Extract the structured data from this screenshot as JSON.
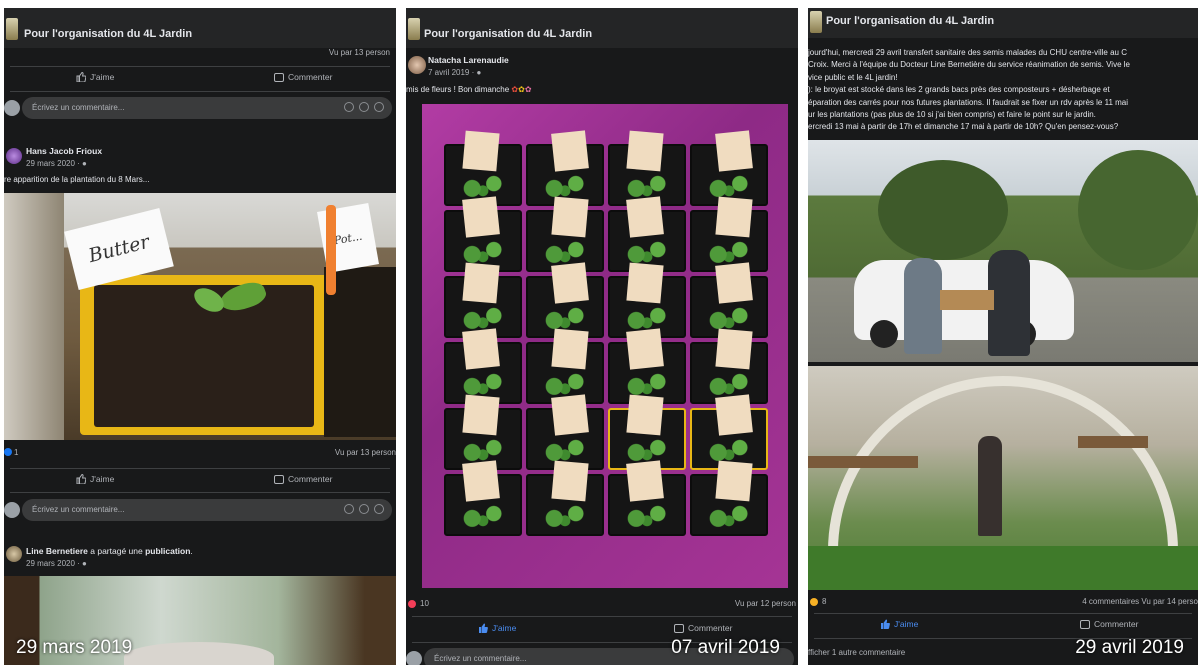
{
  "group_name": "Pour l'organisation du 4L Jardin",
  "common": {
    "like_label": "J'aime",
    "comment_label": "Commenter",
    "comment_placeholder": "Écrivez un commentaire..."
  },
  "panel1": {
    "top_views": "Vu par 13 person",
    "post1": {
      "author": "Hans Jacob Frioux",
      "time": "29 mars 2020 · ",
      "text": "re apparition de la plantation du 8 Mars...",
      "reactions_count": "1",
      "views": "Vu par 13 person",
      "plant_labels": [
        "Butter",
        "Pot..."
      ]
    },
    "post2": {
      "author": "Line Bernetiere",
      "shared": " a partagé une ",
      "shared_what": "publication",
      "shared_end": ".",
      "time": "29 mars 2020 · "
    },
    "date_caption": "29 mars 2019"
  },
  "panel2": {
    "author": "Natacha Larenaudie",
    "time": "7 avril 2019 · ",
    "text": "mis de fleurs ! Bon dimanche",
    "reactions_count": "10",
    "views": "Vu par 12 person",
    "date_caption": "07 avril 2019"
  },
  "panel3": {
    "text_lines": [
      "jourd'hui,  mercredi 29 avril transfert sanitaire des semis malades du CHU  centre-ville au C",
      " Croix. Merci à l'équipe du Docteur Line  Bernetière du service réanimation de semis. Vive le",
      "vice public et le  4L jardin!",
      "): le broyat est stocké dans les 2 grands bacs près des  composteurs + désherbage et",
      "éparation des carrés pour nos futures  plantations. Il faudrait se fixer un rdv après le 11 mai",
      "ur les  plantations (pas plus de 10 si j'ai bien compris) et faire le point sur  le jardin.",
      "ercredi 13 mai à partir de 17h et dimanche 17 mai à partir de 10h? Qu'en pensez-vous?"
    ],
    "reactions_count": "8",
    "stats": "4 commentaires  Vu par 14 perso",
    "more_comments": "fficher 1 autre commentaire",
    "date_caption": "29 avril 2019"
  },
  "colors": {
    "fb_dark_bg": "#18191a",
    "fb_card": "#242526",
    "fb_link_blue": "#4a8cf0",
    "tray_yellow": "#e8b716"
  }
}
